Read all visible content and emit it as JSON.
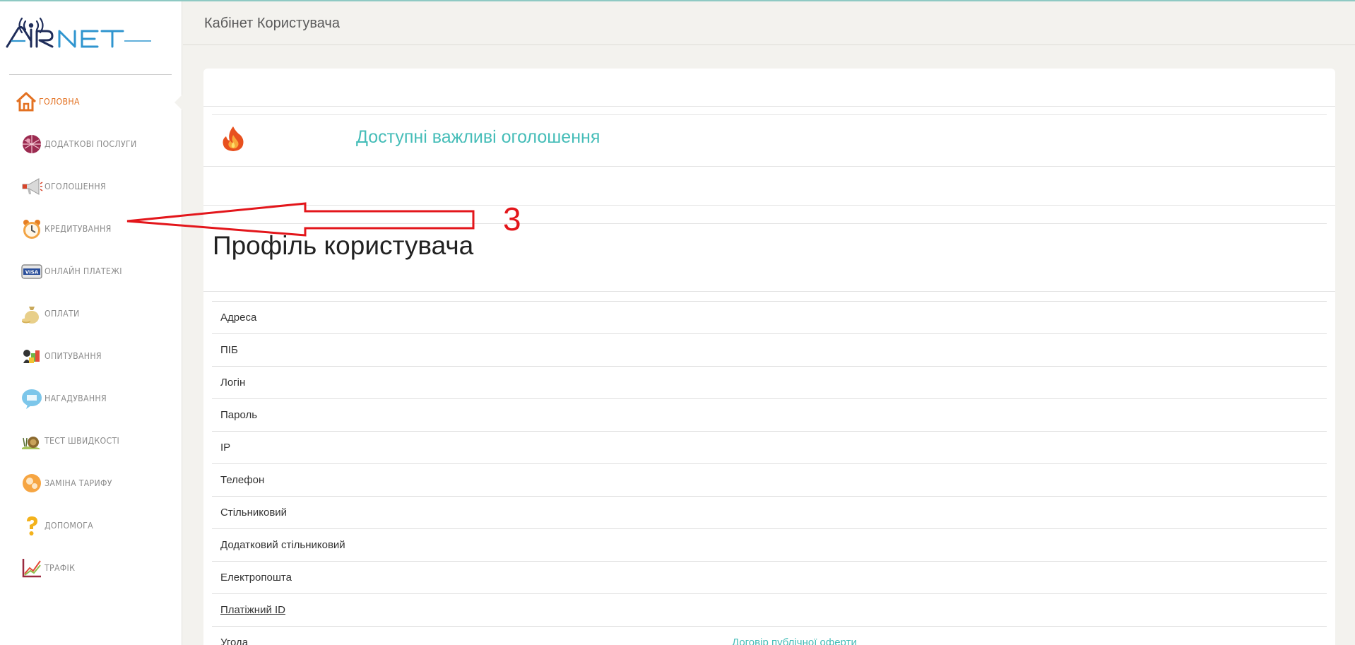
{
  "brand": {
    "logo_text": "AIRNET",
    "accent": "#1f2d5a",
    "logo_blue": "#2f95cf"
  },
  "header": {
    "title": "Кабінет Користувача"
  },
  "sidebar": {
    "items": [
      {
        "label": "ГОЛОВНА",
        "icon": "home-icon",
        "active": true
      },
      {
        "label": "ДОДАТКОВІ ПОСЛУГИ",
        "icon": "globe-icon"
      },
      {
        "label": "ОГОЛОШЕННЯ",
        "icon": "megaphone-icon"
      },
      {
        "label": "КРЕДИТУВАННЯ",
        "icon": "alarm-clock-icon"
      },
      {
        "label": "ОНЛАЙН ПЛАТЕЖІ",
        "icon": "visa-card-icon"
      },
      {
        "label": "ОПЛАТИ",
        "icon": "money-bag-icon"
      },
      {
        "label": "ОПИТУВАННЯ",
        "icon": "survey-icon"
      },
      {
        "label": "НАГАДУВАННЯ",
        "icon": "reminder-bubble-icon"
      },
      {
        "label": "ТЕСТ ШВИДКОСТІ",
        "icon": "snail-icon"
      },
      {
        "label": "ЗАМІНА ТАРИФУ",
        "icon": "tariff-change-icon"
      },
      {
        "label": "ДОПОМОГА",
        "icon": "question-mark-icon"
      },
      {
        "label": "ТРАФІК",
        "icon": "traffic-chart-icon"
      }
    ]
  },
  "announcements": {
    "link_text": "Доступні важливі оголошення",
    "icon": "fire-icon"
  },
  "profile": {
    "title": "Профіль користувача",
    "rows": [
      {
        "label": "Адреса",
        "value": ""
      },
      {
        "label": "ПІБ",
        "value": ""
      },
      {
        "label": "Логін",
        "value": ""
      },
      {
        "label": "Пароль",
        "value": ""
      },
      {
        "label": "IP",
        "value": ""
      },
      {
        "label": "Телефон",
        "value": ""
      },
      {
        "label": "Стільниковий",
        "value": ""
      },
      {
        "label": "Додатковий стільниковий",
        "value": ""
      },
      {
        "label": "Електропошта",
        "value": ""
      },
      {
        "label": "Платіжний ID",
        "value": ""
      },
      {
        "label": "Угода",
        "value": "Договір публічної оферти"
      }
    ]
  },
  "annotation": {
    "number": "3",
    "color": "#e3161b"
  }
}
